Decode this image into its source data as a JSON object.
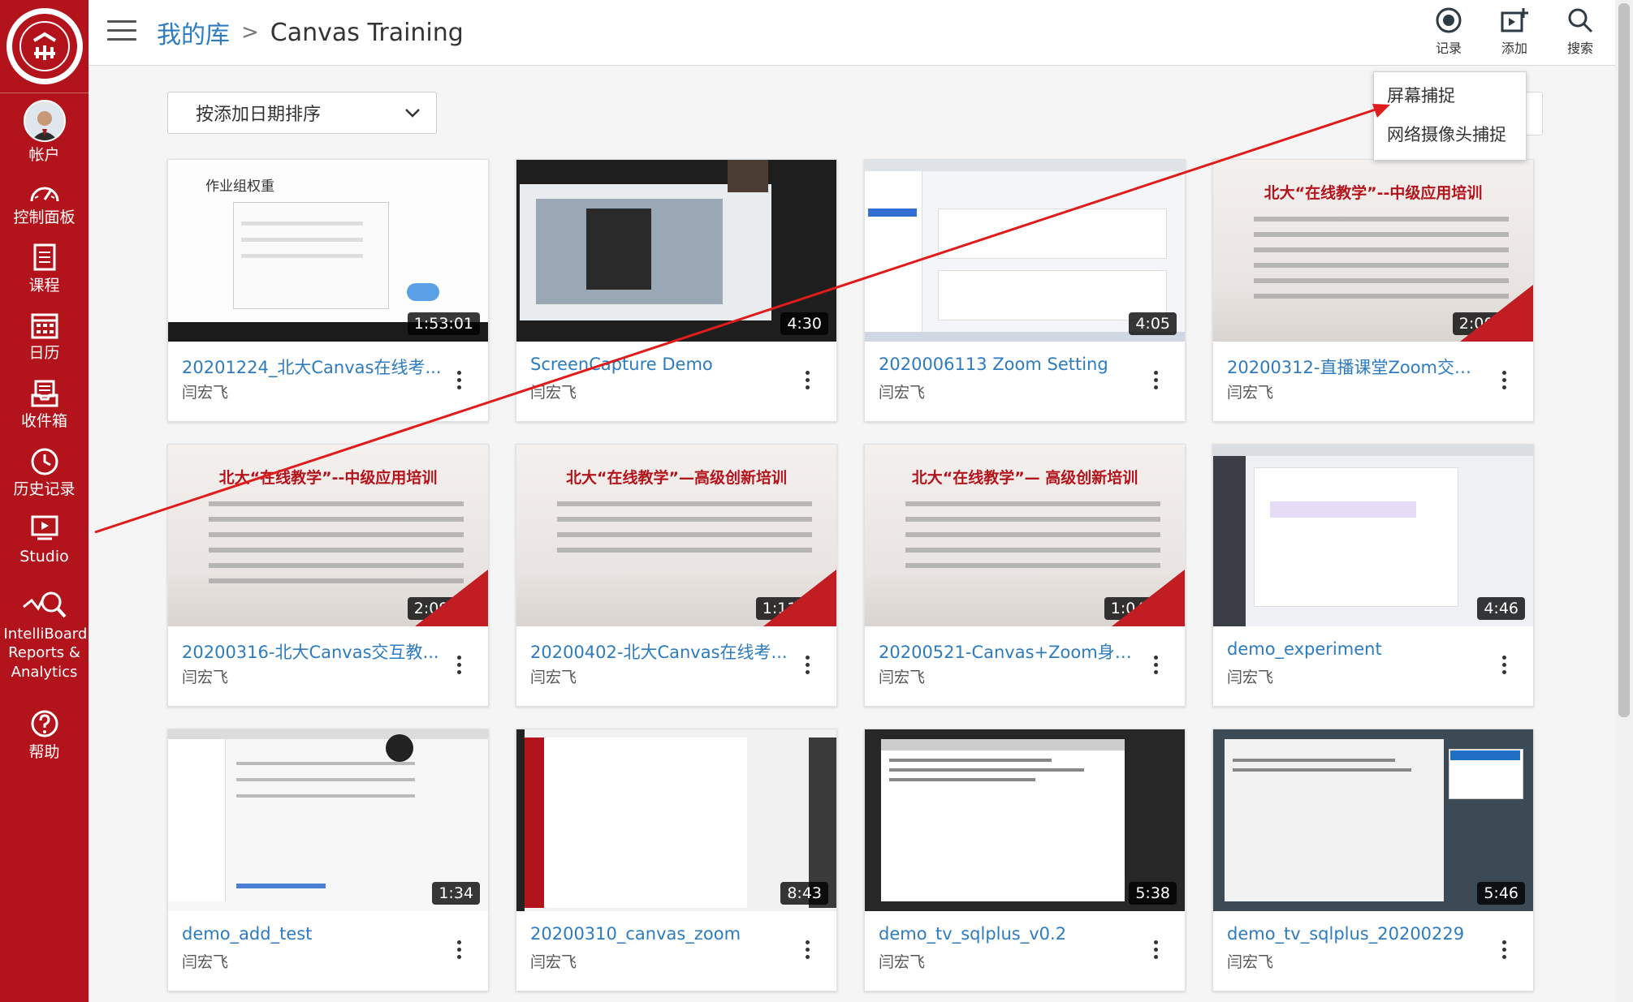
{
  "sidebar": {
    "items": [
      {
        "label": "帐户",
        "icon": "avatar"
      },
      {
        "label": "控制面板",
        "icon": "dashboard-icon"
      },
      {
        "label": "课程",
        "icon": "courses-icon"
      },
      {
        "label": "日历",
        "icon": "calendar-icon"
      },
      {
        "label": "收件箱",
        "icon": "inbox-icon"
      },
      {
        "label": "历史记录",
        "icon": "history-icon"
      },
      {
        "label": "Studio",
        "icon": "studio-icon"
      },
      {
        "label": "IntelliBoard Reports & Analytics",
        "icon": "intelliboard-icon"
      },
      {
        "label": "帮助",
        "icon": "help-icon"
      }
    ]
  },
  "header": {
    "breadcrumb_root": "我的库",
    "breadcrumb_current": "Canvas Training",
    "record_label": "记录",
    "add_label": "添加",
    "search_label": "搜索"
  },
  "sort": {
    "label": "按添加日期排序"
  },
  "capture_menu": {
    "items": [
      "屏幕捕捉",
      "网络摄像头捕捉"
    ]
  },
  "videos": [
    {
      "title": "20201224_北大Canvas在线考...",
      "author": "闫宏飞",
      "duration": "1:53:01"
    },
    {
      "title": "ScreenCapture Demo",
      "author": "闫宏飞",
      "duration": "4:30"
    },
    {
      "title": "2020006113 Zoom Setting",
      "author": "闫宏飞",
      "duration": "4:05"
    },
    {
      "title": "20200312-直播课堂Zoom交互...",
      "author": "闫宏飞",
      "duration": "2:00:51"
    },
    {
      "title": "20200316-北大Canvas交互教...",
      "author": "闫宏飞",
      "duration": "2:09:41"
    },
    {
      "title": "20200402-北大Canvas在线考...",
      "author": "闫宏飞",
      "duration": "1:11:36"
    },
    {
      "title": "20200521-Canvas+Zoom身份...",
      "author": "闫宏飞",
      "duration": "1:04:37"
    },
    {
      "title": "demo_experiment",
      "author": "闫宏飞",
      "duration": "4:46"
    },
    {
      "title": "demo_add_test",
      "author": "闫宏飞",
      "duration": "1:34"
    },
    {
      "title": "20200310_canvas_zoom",
      "author": "闫宏飞",
      "duration": "8:43"
    },
    {
      "title": "demo_tv_sqlplus_v0.2",
      "author": "闫宏飞",
      "duration": "5:38"
    },
    {
      "title": "demo_tv_sqlplus_20200229",
      "author": "闫宏飞",
      "duration": "5:46"
    }
  ],
  "thumbnails": {
    "slide1_title": "作业组权重",
    "slide4_title": "北大“在线教学”--中级应用培训",
    "slide5_title": "北大“在线教学”--中级应用培训",
    "slide6_title": "北大“在线教学”—高级创新培训",
    "slide7_title": "北大“在线教学”— 高级创新培训"
  },
  "colors": {
    "sidebar": "#b3141c",
    "link": "#2d7bc0",
    "annotation": "#e01b1b"
  }
}
